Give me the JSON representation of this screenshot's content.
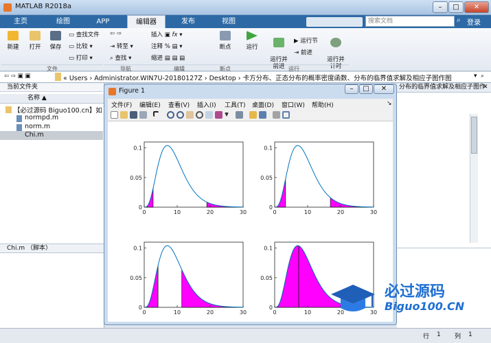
{
  "app": {
    "title": "MATLAB R2018a",
    "tabs": [
      "主页",
      "绘图",
      "APP",
      "编辑器",
      "发布",
      "视图"
    ],
    "active_tab": "编辑器",
    "search_placeholder": "搜索文档",
    "login": "登录"
  },
  "ribbon": {
    "file": {
      "new": "新建",
      "open": "打开",
      "save": "保存",
      "find_files": "查找文件",
      "compare": "比较",
      "print": "打印",
      "label": "文件"
    },
    "navigate": {
      "goto": "转至",
      "find": "查找",
      "label": "导航"
    },
    "edit": {
      "insert": "插入",
      "comment": "注释",
      "indent": "缩进",
      "fx": "fx",
      "label": "编辑"
    },
    "breakpoints": {
      "breakpoints": "断点",
      "label": "断点"
    },
    "run": {
      "run": "运行",
      "run_advance": "运行并\n前进",
      "run_section": "运行节",
      "advance": "前进",
      "run_time": "运行并\n计时",
      "label": "运行"
    }
  },
  "path": {
    "text": "« Users › Administrator.WIN7U-20180127Z › Desktop › 卡方分布、正态分布的概率密度函数、分布的临界值求解及相应子图作图"
  },
  "left_panel": {
    "header": "当前文件夹",
    "column": "名称 ▲",
    "files": [
      "【必过源码 Biguo100.cn】如",
      "normpd.m",
      "norm.m",
      "Chi.m"
    ],
    "selected_file": "Chi.m",
    "details": "Chi.m （脚本）"
  },
  "right_panel": {
    "path_fragment": "分布的临界值求解及相应子图作"
  },
  "status": {
    "row_label": "行",
    "row": "1",
    "col_label": "列",
    "col": "1"
  },
  "figure": {
    "title": "Figure 1",
    "menu": [
      "文件(F)",
      "编辑(E)",
      "查看(V)",
      "插入(I)",
      "工具(T)",
      "桌面(D)",
      "窗口(W)",
      "帮助(H)"
    ]
  },
  "watermark": {
    "text_cn": "必过源码",
    "text_en": "Biguo100.CN"
  },
  "colors": {
    "fill": "#ff00ff",
    "curve": "#0072bd",
    "tab_bar": "#2d6aa5"
  },
  "chart_data": [
    {
      "type": "area",
      "xlim": [
        0,
        30
      ],
      "ylim": [
        0,
        0.11
      ],
      "xticks": [
        0,
        10,
        20,
        30
      ],
      "yticks": [
        0,
        0.05,
        0.1
      ],
      "curve": "chi-square pdf, df=9",
      "shaded": [
        [
          0,
          2.7
        ],
        [
          19.0,
          30
        ]
      ]
    },
    {
      "type": "area",
      "xlim": [
        0,
        30
      ],
      "ylim": [
        0,
        0.11
      ],
      "xticks": [
        0,
        10,
        20,
        30
      ],
      "yticks": [
        0,
        0.05,
        0.1
      ],
      "curve": "chi-square pdf, df=9",
      "shaded": [
        [
          0,
          3.3
        ],
        [
          16.9,
          30
        ]
      ]
    },
    {
      "type": "area",
      "xlim": [
        0,
        30
      ],
      "ylim": [
        0,
        0.11
      ],
      "xticks": [
        0,
        10,
        20,
        30
      ],
      "yticks": [
        0,
        0.05,
        0.1
      ],
      "curve": "chi-square pdf, df=9",
      "shaded": [
        [
          0,
          4.2
        ],
        [
          11.4,
          30
        ]
      ]
    },
    {
      "type": "area",
      "xlim": [
        0,
        30
      ],
      "ylim": [
        0,
        0.11
      ],
      "xticks": [
        0,
        10,
        20,
        30
      ],
      "yticks": [
        0,
        0.05,
        0.1
      ],
      "curve": "chi-square pdf, df=9",
      "shaded": [
        [
          0,
          7.3
        ],
        [
          7.3,
          30
        ]
      ]
    }
  ]
}
